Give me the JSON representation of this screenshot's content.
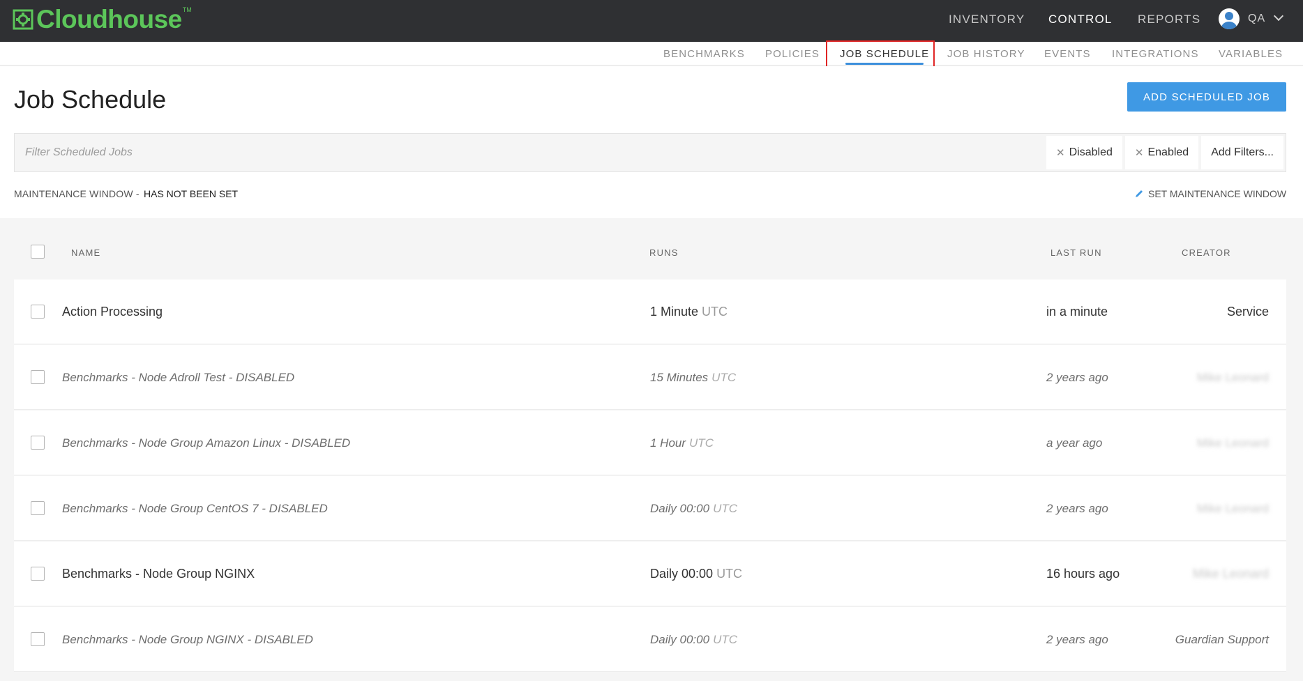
{
  "brand": {
    "name": "Cloudhouse",
    "tm": "TM",
    "color": "#5cc65a"
  },
  "topnav": {
    "inventory": "INVENTORY",
    "control": "CONTROL",
    "reports": "REPORTS"
  },
  "user": {
    "initials": "QA"
  },
  "subnav": {
    "benchmarks": "BENCHMARKS",
    "policies": "POLICIES",
    "job_schedule": "JOB SCHEDULE",
    "job_history": "JOB HISTORY",
    "events": "EVENTS",
    "integrations": "INTEGRATIONS",
    "variables": "VARIABLES"
  },
  "page": {
    "title": "Job Schedule",
    "add_button": "ADD SCHEDULED JOB"
  },
  "filter": {
    "placeholder": "Filter Scheduled Jobs",
    "chip_disabled": "Disabled",
    "chip_enabled": "Enabled",
    "add_filters": "Add Filters..."
  },
  "maintenance": {
    "label": "MAINTENANCE WINDOW -",
    "value": "HAS NOT BEEN SET",
    "set_link": "SET MAINTENANCE WINDOW"
  },
  "table": {
    "headers": {
      "name": "NAME",
      "runs": "RUNS",
      "last_run": "LAST RUN",
      "creator": "CREATOR"
    },
    "rows": [
      {
        "name": "Action Processing",
        "runs": "1 Minute",
        "tz": "UTC",
        "last_run": "in a minute",
        "creator": "Service",
        "disabled": false,
        "creator_blurred": false
      },
      {
        "name": "Benchmarks - Node Adroll Test - DISABLED",
        "runs": "15 Minutes",
        "tz": "UTC",
        "last_run": "2 years ago",
        "creator": "Mike Leonard",
        "disabled": true,
        "creator_blurred": true
      },
      {
        "name": "Benchmarks - Node Group Amazon Linux - DISABLED",
        "runs": "1 Hour",
        "tz": "UTC",
        "last_run": "a year ago",
        "creator": "Mike Leonard",
        "disabled": true,
        "creator_blurred": true
      },
      {
        "name": "Benchmarks - Node Group CentOS 7 - DISABLED",
        "runs": "Daily 00:00",
        "tz": "UTC",
        "last_run": "2 years ago",
        "creator": "Mike Leonard",
        "disabled": true,
        "creator_blurred": true
      },
      {
        "name": "Benchmarks - Node Group NGINX",
        "runs": "Daily 00:00",
        "tz": "UTC",
        "last_run": "16 hours ago",
        "creator": "Mike Leonard",
        "disabled": false,
        "creator_blurred": true
      },
      {
        "name": "Benchmarks - Node Group NGINX - DISABLED",
        "runs": "Daily 00:00",
        "tz": "UTC",
        "last_run": "2 years ago",
        "creator": "Guardian Support",
        "disabled": true,
        "creator_blurred": false
      }
    ]
  },
  "colors": {
    "topbar": "#2f3033",
    "accent": "#3f99e4",
    "highlight": "#e02525"
  }
}
